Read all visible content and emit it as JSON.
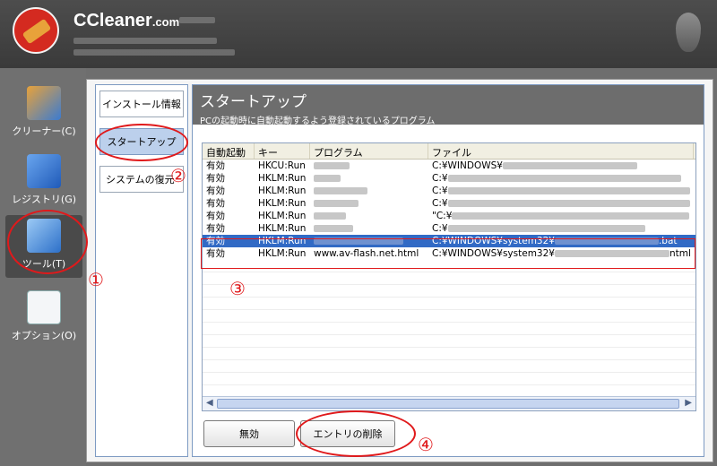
{
  "app": {
    "title": "CCleaner",
    "title_suffix": ".com"
  },
  "nav": [
    {
      "label": "クリーナー(C)",
      "icon": "broom-icon"
    },
    {
      "label": "レジストリ(G)",
      "icon": "registry-cubes-icon"
    },
    {
      "label": "ツール(T)",
      "icon": "wrench-icon"
    },
    {
      "label": "オプション(O)",
      "icon": "checklist-icon"
    }
  ],
  "subnav": [
    {
      "label": "インストール情報"
    },
    {
      "label": "スタートアップ"
    },
    {
      "label": "システムの復元"
    }
  ],
  "content": {
    "title": "スタートアップ",
    "subtitle": "PCの起動時に自動起動するよう登録されているプログラム"
  },
  "table": {
    "headers": [
      "自動起動",
      "キー",
      "プログラム",
      "ファイル"
    ],
    "rows": [
      {
        "enabled": "有効",
        "key": "HKCU:Run",
        "program": "",
        "file": "C:¥WINDOWS¥"
      },
      {
        "enabled": "有効",
        "key": "HKLM:Run",
        "program": "",
        "file": "C:¥"
      },
      {
        "enabled": "有効",
        "key": "HKLM:Run",
        "program": "",
        "file": "C:¥"
      },
      {
        "enabled": "有効",
        "key": "HKLM:Run",
        "program": "",
        "file": "C:¥"
      },
      {
        "enabled": "有効",
        "key": "HKLM:Run",
        "program": "",
        "file": "\"C:¥"
      },
      {
        "enabled": "有効",
        "key": "HKLM:Run",
        "program": "",
        "file": "C:¥"
      },
      {
        "enabled": "有効",
        "key": "HKLM:Run",
        "program": "",
        "file": "C:¥WINDOWS¥system32¥",
        "file_end": ".bat"
      },
      {
        "enabled": "有効",
        "key": "HKLM:Run",
        "program": "www.av-flash.net.html",
        "file": "C:¥WINDOWS¥system32¥",
        "file_end": "ntml"
      }
    ]
  },
  "buttons": {
    "disable": "無効",
    "delete_entry": "エントリの削除"
  },
  "annotations": [
    "①",
    "②",
    "③",
    "④"
  ],
  "colors": {
    "accent_red": "#e0191b",
    "selection_blue": "#316ac5"
  }
}
